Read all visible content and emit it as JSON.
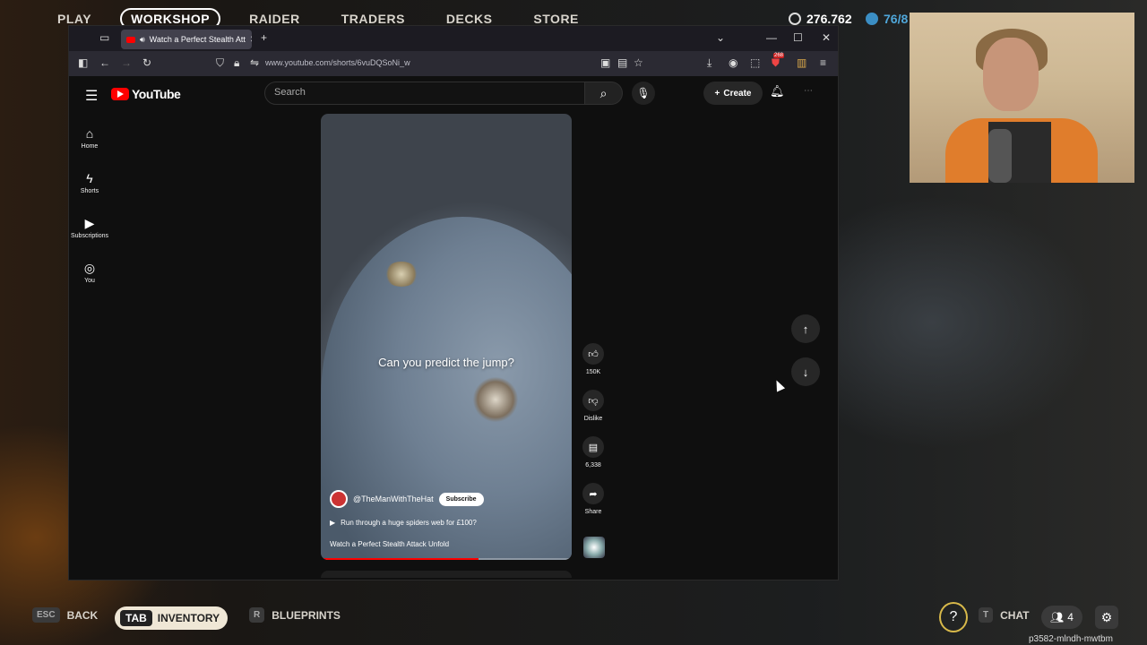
{
  "game": {
    "nav": [
      "PLAY",
      "WORKSHOP",
      "RAIDER",
      "TRADERS",
      "DECKS",
      "STORE"
    ],
    "active_nav": "WORKSHOP",
    "currency1": "276.762",
    "currency2": "76/8",
    "bottom": {
      "back_key": "ESC",
      "back_label": "BACK",
      "inventory_key": "TAB",
      "inventory_label": "INVENTORY",
      "blueprints_key": "R",
      "blueprints_label": "BLUEPRINTS",
      "chat_key": "T",
      "chat_label": "CHAT",
      "party_count": "4"
    },
    "session_id": "p3582-mlndh-mwtbm"
  },
  "browser": {
    "tab_title": "Watch a Perfect Stealth Att",
    "url": "www.youtube.com/shorts/6vuDQSoNi_w",
    "extension_badge": "268"
  },
  "youtube": {
    "logo": "YouTube",
    "search_placeholder": "Search",
    "create_label": "Create",
    "sidebar": [
      {
        "icon": "home-icon",
        "label": "Home"
      },
      {
        "icon": "shorts-icon",
        "label": "Shorts"
      },
      {
        "icon": "subscriptions-icon",
        "label": "Subscriptions"
      },
      {
        "icon": "you-icon",
        "label": "You"
      }
    ],
    "short": {
      "caption": "Can you predict the jump?",
      "channel": "@TheManWithTheHat",
      "subscribe": "Subscribe",
      "related": "Run through a huge spiders web for £100?",
      "title": "Watch a Perfect Stealth Attack Unfold",
      "progress": 0.63
    },
    "actions": {
      "likes": "150K",
      "dislike": "Dislike",
      "comments": "6,338",
      "share": "Share"
    }
  }
}
